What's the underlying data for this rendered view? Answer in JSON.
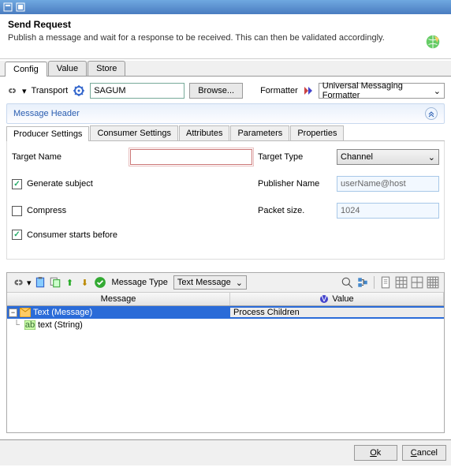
{
  "dialog": {
    "title": "Send Request",
    "description": "Publish a message and wait for a response to be received.  This can then be validated accordingly."
  },
  "tabs": {
    "config": "Config",
    "value": "Value",
    "store": "Store"
  },
  "transport": {
    "label": "Transport",
    "value": "SAGUM",
    "browse": "Browse...",
    "formatter_label": "Formatter",
    "formatter_value": "Universal Messaging Formatter"
  },
  "section": {
    "header": "Message Header"
  },
  "subtabs": {
    "producer": "Producer Settings",
    "consumer": "Consumer Settings",
    "attributes": "Attributes",
    "parameters": "Parameters",
    "properties": "Properties"
  },
  "form": {
    "target_name_label": "Target Name",
    "target_name_value": "",
    "target_type_label": "Target Type",
    "target_type_value": "Channel",
    "generate_subject_label": "Generate subject",
    "publisher_name_label": "Publisher Name",
    "publisher_name_value": "userName@host",
    "compress_label": "Compress",
    "packet_size_label": "Packet size.",
    "packet_size_value": "1024",
    "consumer_starts_label": "Consumer starts before"
  },
  "msgpanel": {
    "message_type_label": "Message Type",
    "message_type_value": "Text Message",
    "col_message": "Message",
    "col_value": "Value",
    "root_node": "Text (Message)",
    "root_value": "Process Children",
    "child_node": "text (String)"
  },
  "buttons": {
    "ok": "Ok",
    "cancel": "Cancel"
  }
}
